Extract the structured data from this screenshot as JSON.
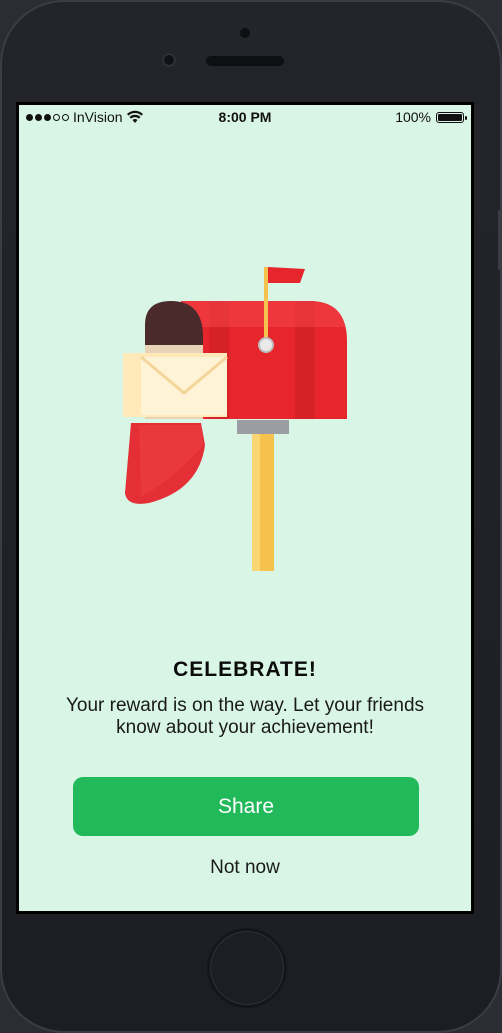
{
  "status_bar": {
    "carrier": "InVision",
    "time": "8:00 PM",
    "battery_text": "100%",
    "signal_bars_filled": 3,
    "signal_bars_total": 5,
    "battery_level": 1.0
  },
  "content": {
    "title": "CELEBRATE!",
    "subtitle": "Your reward is on the way. Let your friends know about your achievement!",
    "share_label": "Share",
    "not_now_label": "Not now"
  },
  "colors": {
    "screen_background": "#d8f5e5",
    "share_button": "#22b95a",
    "mailbox_red": "#e6262c",
    "post_yellow": "#f5c24d"
  },
  "icons": {
    "illustration": "mailbox-with-letter-icon",
    "wifi": "wifi-icon",
    "battery": "battery-icon"
  }
}
